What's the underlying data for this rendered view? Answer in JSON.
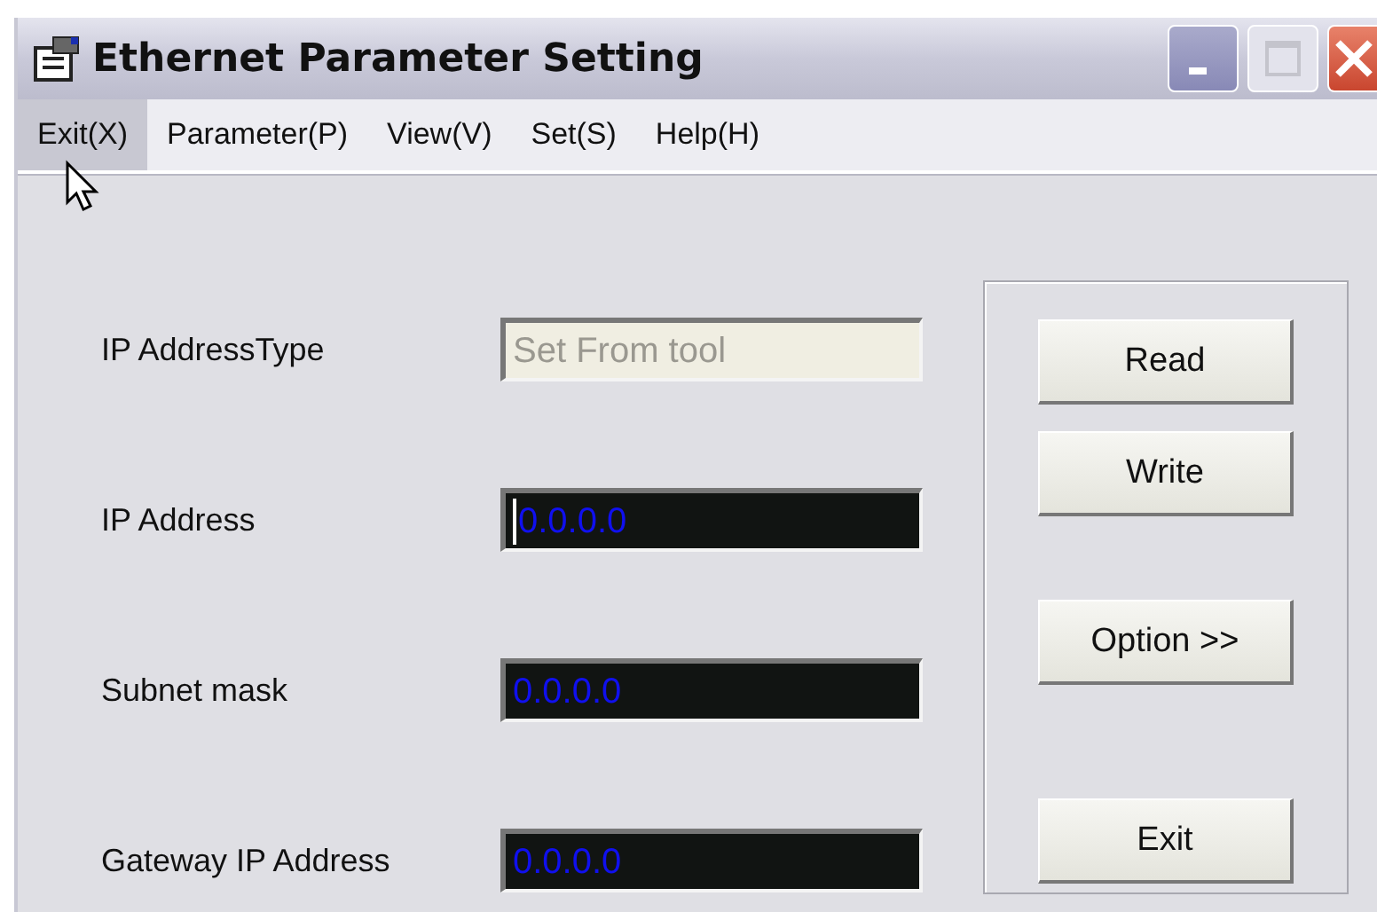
{
  "window": {
    "title": "Ethernet Parameter Setting",
    "controls": [
      {
        "kind": "minimize",
        "disabled": false
      },
      {
        "kind": "maximize",
        "disabled": true
      },
      {
        "kind": "close",
        "disabled": false
      }
    ]
  },
  "menu": [
    {
      "label": "Exit(X)",
      "selected": true
    },
    {
      "label": "Parameter(P)",
      "selected": false
    },
    {
      "label": "View(V)",
      "selected": false
    },
    {
      "label": "Set(S)",
      "selected": false
    },
    {
      "label": "Help(H)",
      "selected": false
    }
  ],
  "fields": [
    {
      "label": "IP AddressType",
      "value": "Set From tool",
      "disabled": true,
      "focused": false
    },
    {
      "label": "IP Address",
      "value": "0.0.0.0",
      "disabled": false,
      "focused": true
    },
    {
      "label": "Subnet mask",
      "value": "0.0.0.0",
      "disabled": false,
      "focused": false
    },
    {
      "label": "Gateway IP Address",
      "value": "0.0.0.0",
      "disabled": false,
      "focused": false
    }
  ],
  "buttons": [
    "Read",
    "Write",
    "Option >>",
    "Exit"
  ]
}
